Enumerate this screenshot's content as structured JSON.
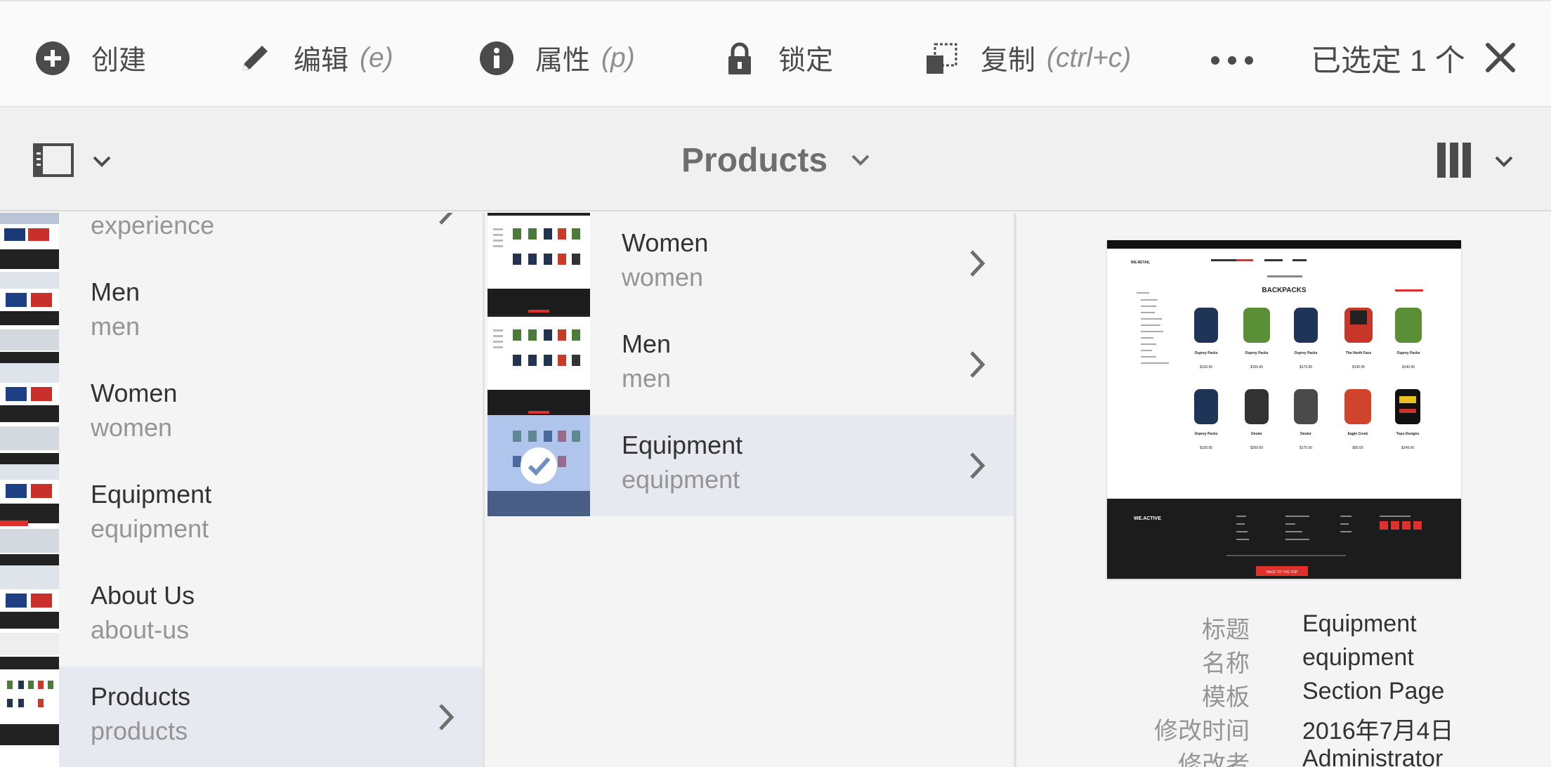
{
  "actionbar": {
    "create": {
      "label": "创建"
    },
    "edit": {
      "label": "编辑",
      "shortcut": "(e)"
    },
    "properties": {
      "label": "属性",
      "shortcut": "(p)"
    },
    "lock": {
      "label": "锁定"
    },
    "copy": {
      "label": "复制",
      "shortcut": "(ctrl+c)"
    },
    "selection_text": "已选定 1 个"
  },
  "header": {
    "title": "Products"
  },
  "column1": {
    "items": [
      {
        "name": "",
        "sub": "experience"
      },
      {
        "name": "Men",
        "sub": "men"
      },
      {
        "name": "Women",
        "sub": "women"
      },
      {
        "name": "Equipment",
        "sub": "equipment"
      },
      {
        "name": "About Us",
        "sub": "about-us"
      },
      {
        "name": "Products",
        "sub": "products",
        "selected": true
      }
    ]
  },
  "column2": {
    "items": [
      {
        "name": "Women",
        "sub": "women"
      },
      {
        "name": "Men",
        "sub": "men"
      },
      {
        "name": "Equipment",
        "sub": "equipment",
        "selected": true
      }
    ]
  },
  "preview_page": {
    "heading": "BACKPACKS",
    "brand": "WE.RETAIL",
    "footer_brand": "WE.ACTIVE",
    "footer_button": "BACK TO THE TOP",
    "products_row1": [
      "Osprey Packs",
      "Osprey Packs",
      "Osprey Packs",
      "The North Face",
      "Osprey Packs"
    ],
    "prices_row1": [
      "$159.95",
      "$159.95",
      "$179.95",
      "$140.95",
      "$140.95"
    ],
    "products_row2": [
      "Osprey Packs",
      "Deuter",
      "Deuter",
      "Eagle Creek",
      "Topo Designs"
    ],
    "prices_row2": [
      "$159.95",
      "$269.00",
      "$175.00",
      "$80.00",
      "$249.00"
    ]
  },
  "metadata": [
    {
      "key": "标题",
      "value": "Equipment"
    },
    {
      "key": "名称",
      "value": "equipment"
    },
    {
      "key": "模板",
      "value": "Section Page"
    },
    {
      "key": "修改时间",
      "value": "2016年7月4日"
    },
    {
      "key": "修改者",
      "value": "Administrator"
    }
  ],
  "colors": {
    "selected_row": "#e7e9f0",
    "text_primary": "#323232",
    "text_secondary": "#959595",
    "check_overlay": "#6e96dc",
    "preview_accent": "#e0302b"
  }
}
